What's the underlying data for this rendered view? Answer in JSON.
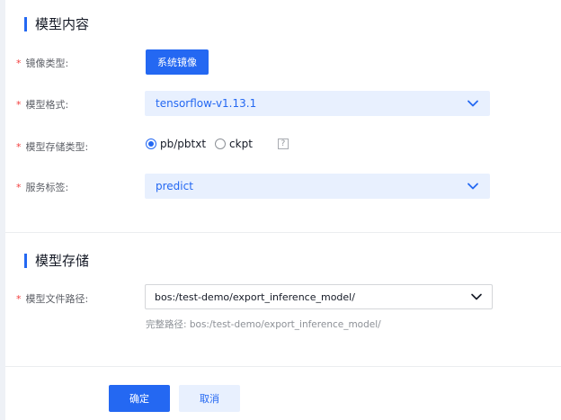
{
  "section_content": {
    "title": "模型内容"
  },
  "fields": {
    "image_type": {
      "label": "镜像类型:",
      "required_mark": "*",
      "button_label": "系统镜像"
    },
    "model_format": {
      "label": "模型格式:",
      "required_mark": "*",
      "value": "tensorflow-v1.13.1"
    },
    "storage_type": {
      "label": "模型存储类型:",
      "required_mark": "*",
      "options": [
        {
          "label": "pb/pbtxt",
          "selected": true
        },
        {
          "label": "ckpt",
          "selected": false
        }
      ],
      "help_glyph": "?"
    },
    "service_tag": {
      "label": "服务标签:",
      "required_mark": "*",
      "value": "predict"
    }
  },
  "section_storage": {
    "title": "模型存储"
  },
  "storage": {
    "file_path": {
      "label": "模型文件路径:",
      "required_mark": "*",
      "value": "bos:/test-demo/export_inference_model/",
      "hint": "完整路径: bos:/test-demo/export_inference_model/"
    }
  },
  "actions": {
    "confirm_label": "确定",
    "cancel_label": "取消"
  },
  "icons": {
    "dropdown": "chevron-down-icon",
    "help": "help-icon"
  },
  "colors": {
    "primary": "#2468f2",
    "tinted_bg": "#e8f0fe",
    "required": "#f33e3e",
    "label": "#5c5f66",
    "hint": "#8c9096"
  }
}
